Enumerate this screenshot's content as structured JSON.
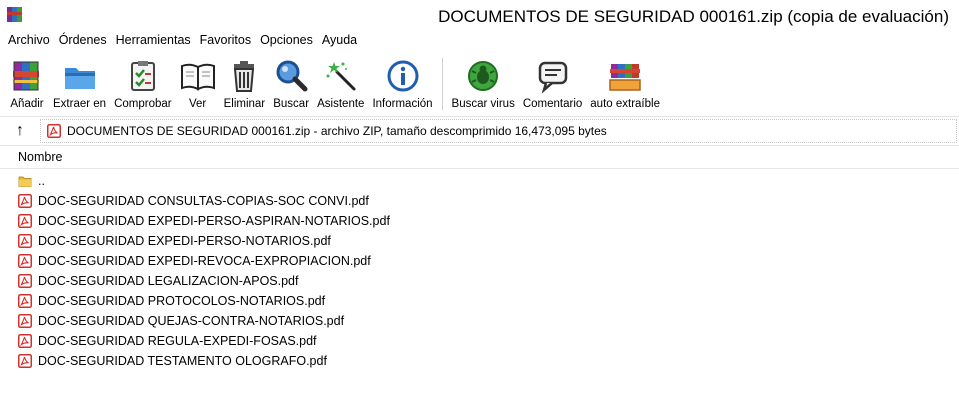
{
  "window": {
    "title": "DOCUMENTOS DE SEGURIDAD 000161.zip (copia de evaluación)"
  },
  "menubar": {
    "items": [
      {
        "label": "Archivo"
      },
      {
        "label": "Órdenes"
      },
      {
        "label": "Herramientas"
      },
      {
        "label": "Favoritos"
      },
      {
        "label": "Opciones"
      },
      {
        "label": "Ayuda"
      }
    ]
  },
  "toolbar": {
    "buttons": [
      {
        "label": "Añadir",
        "icon": "add-archive-icon"
      },
      {
        "label": "Extraer en",
        "icon": "extract-folder-icon"
      },
      {
        "label": "Comprobar",
        "icon": "test-clipboard-icon"
      },
      {
        "label": "Ver",
        "icon": "view-book-icon"
      },
      {
        "label": "Eliminar",
        "icon": "trash-icon"
      },
      {
        "label": "Buscar",
        "icon": "magnifier-icon"
      },
      {
        "label": "Asistente",
        "icon": "wizard-wand-icon"
      },
      {
        "label": "Información",
        "icon": "info-icon"
      },
      {
        "label": "Buscar virus",
        "icon": "virus-scan-icon"
      },
      {
        "label": "Comentario",
        "icon": "comment-icon"
      },
      {
        "label": "auto extraíble",
        "icon": "sfx-icon"
      }
    ]
  },
  "addressbar": {
    "up_icon": "↑",
    "path": "DOCUMENTOS DE SEGURIDAD 000161.zip - archivo ZIP, tamaño descomprimido 16,473,095 bytes"
  },
  "filelist": {
    "column_header": "Nombre",
    "parent": "..",
    "files": [
      {
        "name": "DOC-SEGURIDAD CONSULTAS-COPIAS-SOC CONVI.pdf"
      },
      {
        "name": "DOC-SEGURIDAD EXPEDI-PERSO-ASPIRAN-NOTARIOS.pdf"
      },
      {
        "name": "DOC-SEGURIDAD EXPEDI-PERSO-NOTARIOS.pdf"
      },
      {
        "name": "DOC-SEGURIDAD EXPEDI-REVOCA-EXPROPIACION.pdf"
      },
      {
        "name": "DOC-SEGURIDAD LEGALIZACION-APOS.pdf"
      },
      {
        "name": "DOC-SEGURIDAD PROTOCOLOS-NOTARIOS.pdf"
      },
      {
        "name": "DOC-SEGURIDAD QUEJAS-CONTRA-NOTARIOS.pdf"
      },
      {
        "name": "DOC-SEGURIDAD REGULA-EXPEDI-FOSAS.pdf"
      },
      {
        "name": "DOC-SEGURIDAD TESTAMENTO OLOGRAFO.pdf"
      }
    ]
  },
  "colors": {
    "pdf_red": "#d0312d",
    "folder_yellow": "#e8b830"
  }
}
